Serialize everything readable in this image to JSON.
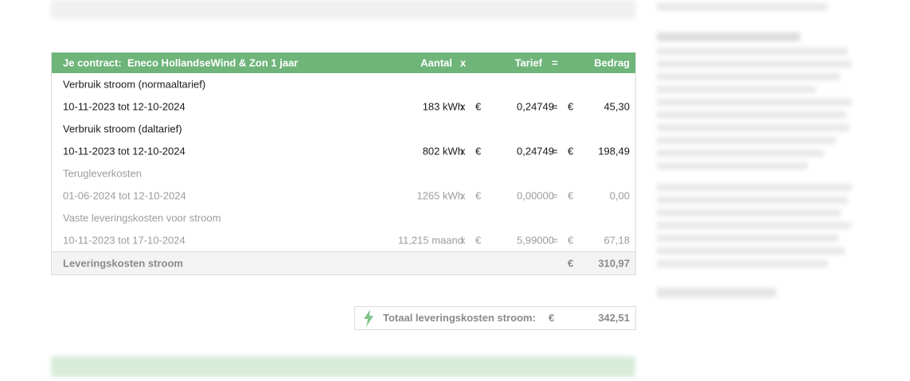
{
  "header": {
    "contract_label": "Je contract:",
    "contract_name": "Eneco HollandseWind & Zon 1 jaar",
    "aantal": "Aantal",
    "x": "x",
    "tarief": "Tarief",
    "eq": "=",
    "bedrag": "Bedrag"
  },
  "rows": [
    {
      "name": "Verbruik stroom (normaaltarief)"
    },
    {
      "name": "10-11-2023 tot 12-10-2024",
      "amount": "183 kWh",
      "x": "x",
      "eur1": "€",
      "tarief": "0,24749",
      "eq": "=",
      "eur2": "€",
      "bedrag": "45,30"
    },
    {
      "name": "Verbruik stroom (daltarief)"
    },
    {
      "name": "10-11-2023 tot 12-10-2024",
      "amount": "802 kWh",
      "x": "x",
      "eur1": "€",
      "tarief": "0,24749",
      "eq": "=",
      "eur2": "€",
      "bedrag": "198,49"
    },
    {
      "name": "Terugleverkosten"
    },
    {
      "name": "01-06-2024 tot 12-10-2024",
      "amount": "1265 kWh",
      "x": "x",
      "eur1": "€",
      "tarief": "0,00000",
      "eq": "=",
      "eur2": "€",
      "bedrag": "0,00"
    },
    {
      "name": "Vaste leveringskosten voor stroom"
    },
    {
      "name": "10-11-2023 tot 17-10-2024",
      "amount": "11,215 maand",
      "x": "x",
      "eur1": "€",
      "tarief": "5,99000",
      "eq": "=",
      "eur2": "€",
      "bedrag": "67,18"
    }
  ],
  "total": {
    "label": "Leveringskosten stroom",
    "eur": "€",
    "value": "310,97"
  },
  "summary": {
    "icon": "lightning-icon",
    "label": "Totaal leveringskosten stroom:",
    "eur": "€",
    "value": "342,51"
  },
  "colors": {
    "header_bg": "#6fb57a",
    "muted_text": "#9c9c9c"
  }
}
